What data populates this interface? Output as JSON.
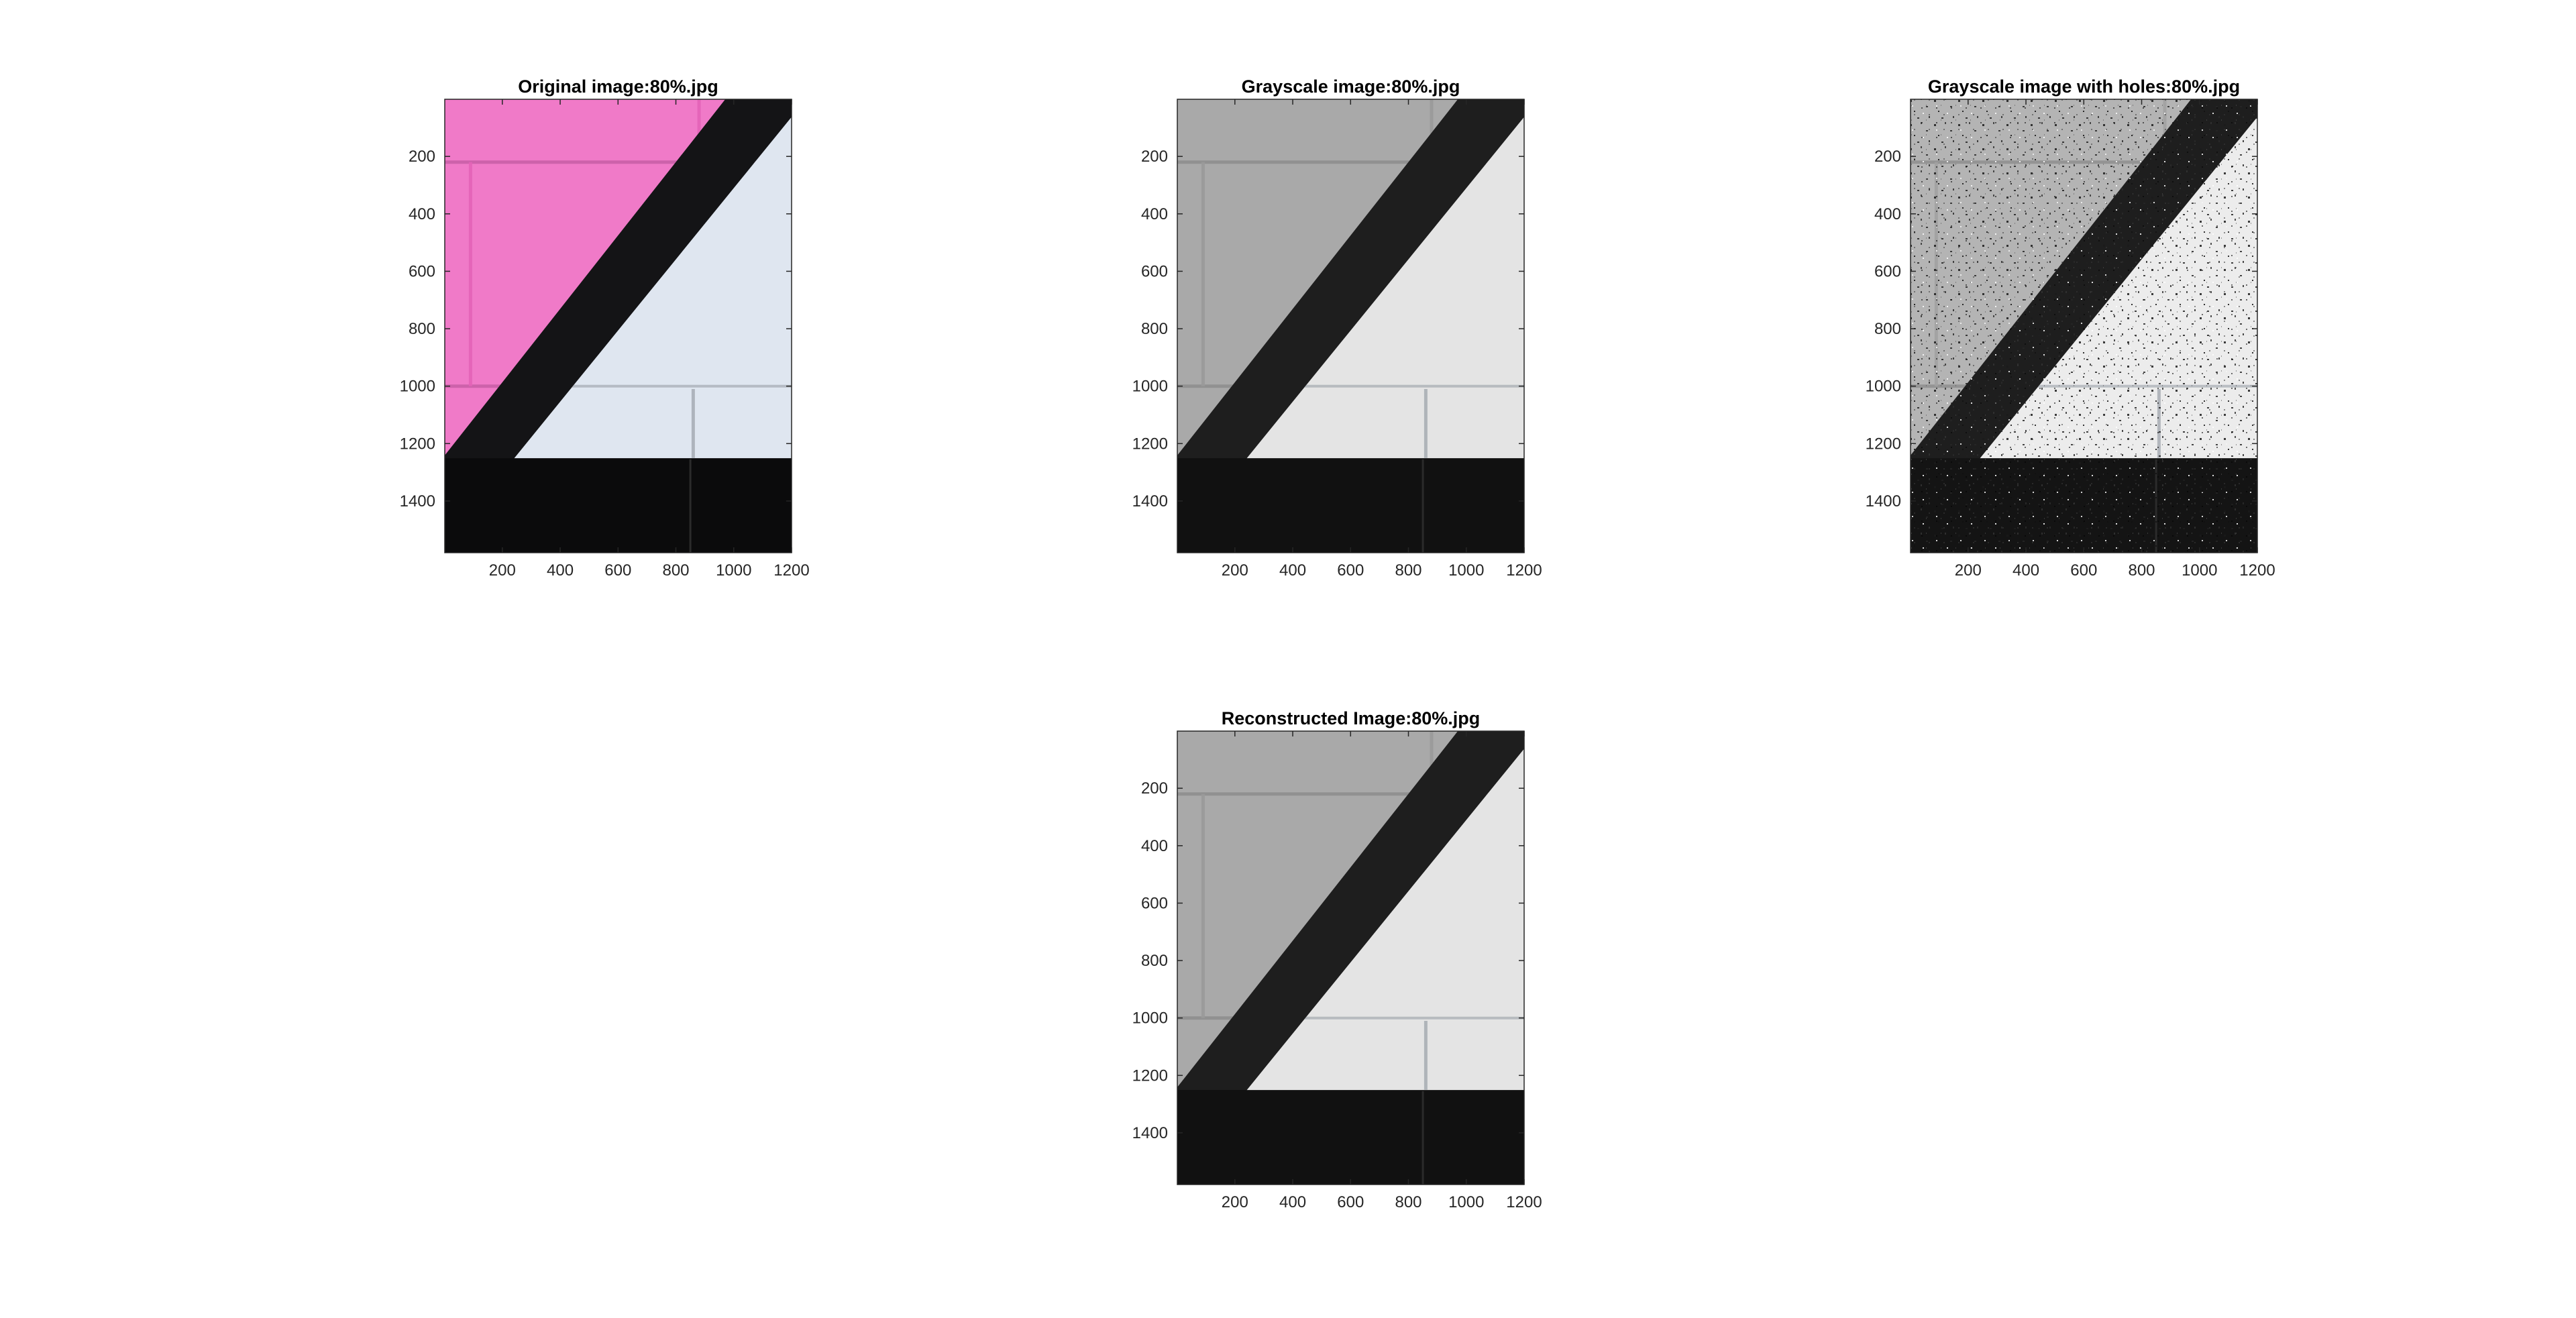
{
  "chart_data": [
    {
      "type": "image",
      "title": "Original image:80%.jpg",
      "variant": "color",
      "x_ticks": [
        200,
        400,
        600,
        800,
        1000,
        1200
      ],
      "y_ticks": [
        200,
        400,
        600,
        800,
        1000,
        1200,
        1400
      ],
      "xlim": [
        1,
        1200
      ],
      "ylim": [
        1,
        1580
      ],
      "colors": {
        "wall": "#f07ac8",
        "wall_dark": "#e463b8",
        "stripe": "#141416",
        "light": "#dfe6f0",
        "floor": "#0b0b0c",
        "mortar": "#c25aa2"
      }
    },
    {
      "type": "image",
      "title": "Grayscale image:80%.jpg",
      "variant": "gray",
      "x_ticks": [
        200,
        400,
        600,
        800,
        1000,
        1200
      ],
      "y_ticks": [
        200,
        400,
        600,
        800,
        1000,
        1200,
        1400
      ],
      "xlim": [
        1,
        1200
      ],
      "ylim": [
        1,
        1580
      ],
      "colors": {
        "wall": "#a9a9a9",
        "wall_dark": "#9a9a9a",
        "stripe": "#1e1e1e",
        "light": "#e4e4e4",
        "floor": "#111111",
        "mortar": "#8a8a8a"
      }
    },
    {
      "type": "image",
      "title": "Grayscale image with holes:80%.jpg",
      "variant": "holes",
      "x_ticks": [
        200,
        400,
        600,
        800,
        1000,
        1200
      ],
      "y_ticks": [
        200,
        400,
        600,
        800,
        1000,
        1200,
        1400
      ],
      "xlim": [
        1,
        1200
      ],
      "ylim": [
        1,
        1580
      ],
      "colors": {
        "wall": "#b4b4b4",
        "wall_dark": "#a2a2a2",
        "stripe": "#1e1e1e",
        "light": "#ececec",
        "floor": "#141414",
        "mortar": "#8a8a8a"
      }
    },
    {
      "type": "image",
      "title": "Reconstructed Image:80%.jpg",
      "variant": "gray",
      "x_ticks": [
        200,
        400,
        600,
        800,
        1000,
        1200
      ],
      "y_ticks": [
        200,
        400,
        600,
        800,
        1000,
        1200,
        1400
      ],
      "xlim": [
        1,
        1200
      ],
      "ylim": [
        1,
        1580
      ],
      "colors": {
        "wall": "#a9a9a9",
        "wall_dark": "#9a9a9a",
        "stripe": "#1e1e1e",
        "light": "#e4e4e4",
        "floor": "#111111",
        "mortar": "#8a8a8a"
      }
    }
  ]
}
